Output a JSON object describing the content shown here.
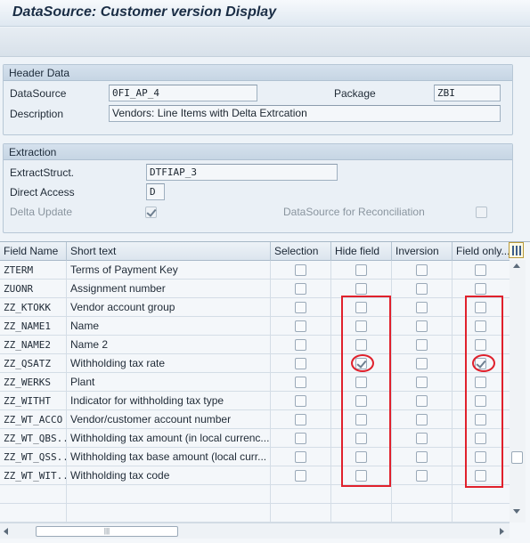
{
  "window": {
    "title": "DataSource: Customer version Display"
  },
  "header_group": {
    "title": "Header Data",
    "datasource_label": "DataSource",
    "datasource_value": "0FI_AP_4",
    "package_label": "Package",
    "package_value": "ZBI",
    "description_label": "Description",
    "description_value": "Vendors: Line Items with Delta Extrcation"
  },
  "extraction_group": {
    "title": "Extraction",
    "extractstruct_label": "ExtractStruct.",
    "extractstruct_value": "DTFIAP_3",
    "direct_access_label": "Direct Access",
    "direct_access_value": "D",
    "delta_update_label": "Delta Update",
    "delta_update_checked": true,
    "reconciliation_label": "DataSource for Reconciliation",
    "reconciliation_checked": false
  },
  "table": {
    "columns": [
      "Field Name",
      "Short text",
      "Selection",
      "Hide field",
      "Inversion",
      "Field only..."
    ],
    "rows": [
      {
        "field": "ZTERM",
        "text": "Terms of Payment Key",
        "selection": false,
        "hide": false,
        "inversion": false,
        "field_only": false
      },
      {
        "field": "ZUONR",
        "text": "Assignment number",
        "selection": false,
        "hide": false,
        "inversion": false,
        "field_only": false
      },
      {
        "field": "ZZ_KTOKK",
        "text": "Vendor account group",
        "selection": false,
        "hide": false,
        "inversion": false,
        "field_only": false
      },
      {
        "field": "ZZ_NAME1",
        "text": "Name",
        "selection": false,
        "hide": false,
        "inversion": false,
        "field_only": false
      },
      {
        "field": "ZZ_NAME2",
        "text": "Name 2",
        "selection": false,
        "hide": false,
        "inversion": false,
        "field_only": false
      },
      {
        "field": "ZZ_QSATZ",
        "text": "Withholding tax rate",
        "selection": false,
        "hide": true,
        "inversion": false,
        "field_only": true
      },
      {
        "field": "ZZ_WERKS",
        "text": "Plant",
        "selection": false,
        "hide": false,
        "inversion": false,
        "field_only": false
      },
      {
        "field": "ZZ_WITHT",
        "text": "Indicator for withholding tax type",
        "selection": false,
        "hide": false,
        "inversion": false,
        "field_only": false
      },
      {
        "field": "ZZ_WT_ACCO",
        "text": "Vendor/customer account number",
        "selection": false,
        "hide": false,
        "inversion": false,
        "field_only": false
      },
      {
        "field": "ZZ_WT_QBS...",
        "text": "Withholding tax amount (in local currenc...",
        "selection": false,
        "hide": false,
        "inversion": false,
        "field_only": false
      },
      {
        "field": "ZZ_WT_QSS...",
        "text": "Withholding tax base amount (local curr...",
        "selection": false,
        "hide": false,
        "inversion": false,
        "field_only": false
      },
      {
        "field": "ZZ_WT_WIT...",
        "text": "Withholding tax code",
        "selection": false,
        "hide": false,
        "inversion": false,
        "field_only": false
      }
    ],
    "empty_rows": 2
  },
  "icons": {
    "settings": "table-settings-icon",
    "scroll_up": "scroll-up-icon",
    "scroll_down": "scroll-down-icon",
    "scroll_left": "scroll-left-icon",
    "scroll_right": "scroll-right-icon"
  },
  "colors": {
    "highlight": "#e0212c",
    "title_bar": "#dfe8f1",
    "group_header": "#c6d5e4"
  }
}
